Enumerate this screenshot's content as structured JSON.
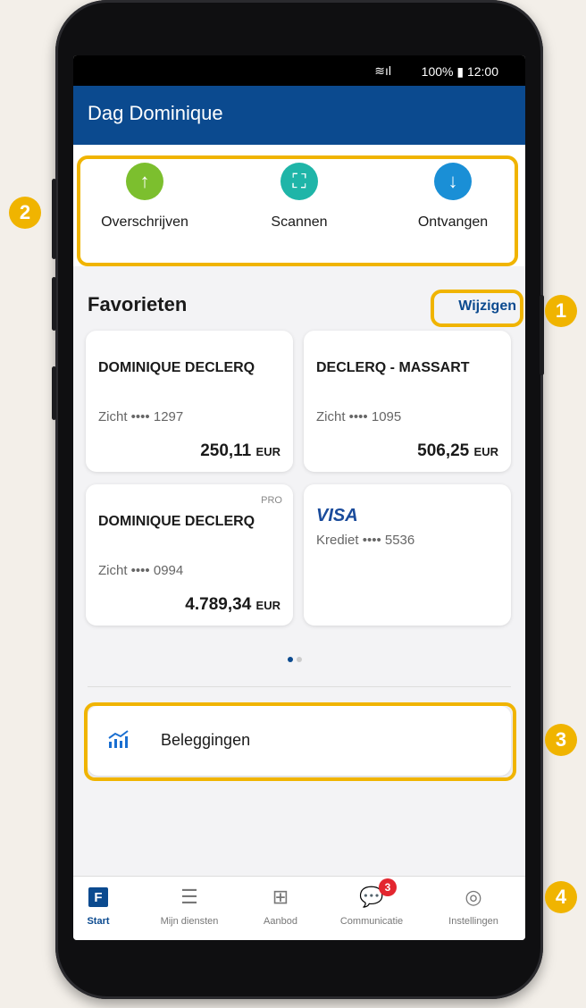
{
  "status_bar": {
    "wifi_icon": "wifi-signal-icon",
    "text": "100% ▮ 12:00"
  },
  "header": {
    "greeting": "Dag Dominique"
  },
  "actions": [
    {
      "label": "Overschrijven",
      "icon": "↑",
      "color": "#7cbf2e"
    },
    {
      "label": "Scannen",
      "icon": "⛶",
      "color": "#1fb5a8"
    },
    {
      "label": "Ontvangen",
      "icon": "↓",
      "color": "#1a8fd6"
    }
  ],
  "favorites": {
    "title": "Favorieten",
    "edit_label": "Wijzigen",
    "cards": [
      {
        "name": "DOMINIQUE DECLERQ",
        "account": "Zicht •••• 1297",
        "amount": "250,11",
        "currency": "EUR"
      },
      {
        "name": "DECLERQ - MASSART",
        "account": "Zicht •••• 1095",
        "amount": "506,25",
        "currency": "EUR"
      },
      {
        "badge": "PRO",
        "name": "DOMINIQUE DECLERQ",
        "account": "Zicht •••• 0994",
        "amount": "4.789,34",
        "currency": "EUR"
      },
      {
        "brand": "VISA",
        "account": "Krediet •••• 5536"
      }
    ]
  },
  "investments": {
    "label": "Beleggingen",
    "icon": "chart-icon"
  },
  "navigation": {
    "items": [
      {
        "label": "Start",
        "icon": "F"
      },
      {
        "label": "Mijn diensten",
        "icon": "☰"
      },
      {
        "label": "Aanbod",
        "icon": "⊞"
      },
      {
        "label": "Communicatie",
        "icon": "💬",
        "badge": "3"
      },
      {
        "label": "Instellingen",
        "icon": "◎"
      }
    ]
  },
  "callouts": [
    "1",
    "2",
    "3",
    "4"
  ],
  "colors": {
    "brand_blue": "#0b4a8f",
    "highlight": "#f0b400",
    "badge_red": "#e3262f"
  }
}
